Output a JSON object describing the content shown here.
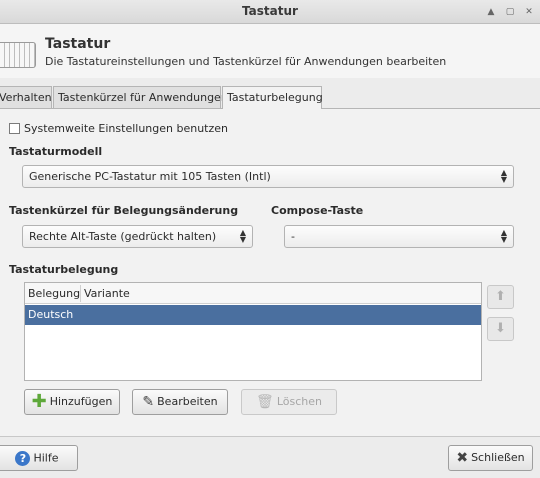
{
  "window": {
    "title": "Tastatur"
  },
  "header": {
    "title": "Tastatur",
    "subtitle": "Die Tastatureinstellungen und Tastenkürzel für Anwendungen bearbeiten"
  },
  "tabs": [
    {
      "label": "Verhalten",
      "active": false
    },
    {
      "label": "Tastenkürzel für Anwendungen",
      "active": false
    },
    {
      "label": "Tastaturbelegung",
      "active": true
    }
  ],
  "systemwide": {
    "label": "Systemweite Einstellungen benutzen",
    "checked": false
  },
  "model": {
    "section": "Tastaturmodell",
    "value": "Generische PC-Tastatur mit 105 Tasten (Intl)"
  },
  "switch_shortcut": {
    "section": "Tastenkürzel für Belegungsänderung",
    "value": "Rechte Alt-Taste (gedrückt halten)"
  },
  "compose": {
    "section": "Compose-Taste",
    "value": "-"
  },
  "layout": {
    "section": "Tastaturbelegung",
    "columns": [
      "Belegung",
      "Variante"
    ],
    "rows": [
      {
        "layout": "Deutsch",
        "variant": "",
        "selected": true
      }
    ]
  },
  "buttons": {
    "add": "Hinzufügen",
    "edit": "Bearbeiten",
    "delete": "Löschen",
    "help": "Hilfe",
    "close": "Schließen"
  },
  "icons": {
    "add": "plus-icon",
    "edit": "pen-icon",
    "delete": "trash-icon",
    "help": "help-icon",
    "close": "close-icon",
    "up": "arrow-up-icon",
    "down": "arrow-down-icon"
  },
  "colors": {
    "selection": "#4a6f9f",
    "add_icon": "#5ea83a",
    "help_icon": "#3b77c9"
  }
}
